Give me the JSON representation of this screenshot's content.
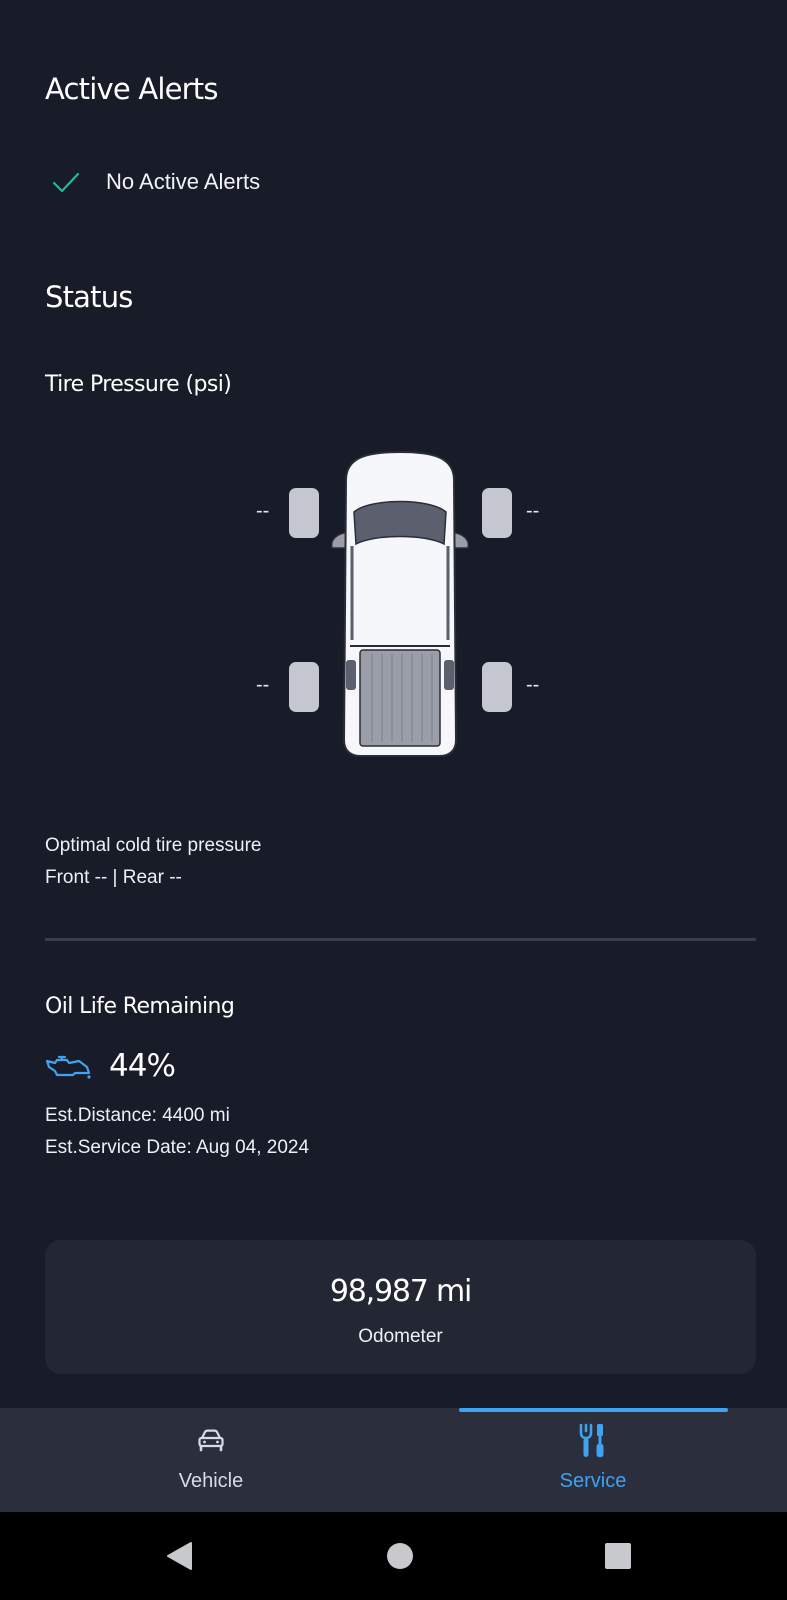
{
  "alerts": {
    "title": "Active Alerts",
    "status_text": "No Active Alerts"
  },
  "status": {
    "title": "Status",
    "tire_pressure": {
      "title": "Tire Pressure (psi)",
      "front_left": "--",
      "front_right": "--",
      "rear_left": "--",
      "rear_right": "--",
      "optimal_label": "Optimal cold tire pressure",
      "optimal_values": "Front -- | Rear --"
    },
    "oil_life": {
      "title": "Oil Life Remaining",
      "percent": "44%",
      "est_distance": "Est.Distance: 4400 mi",
      "est_service_date": "Est.Service Date: Aug 04, 2024"
    },
    "odometer": {
      "value": "98,987 mi",
      "label": "Odometer"
    }
  },
  "bottom_nav": {
    "items": [
      {
        "label": "Vehicle",
        "icon": "car-icon",
        "selected": false
      },
      {
        "label": "Service",
        "icon": "wrench-screwdriver-icon",
        "selected": true
      }
    ]
  },
  "android_nav": {
    "back_icon": "back-triangle-icon",
    "home_icon": "home-circle-icon",
    "recents_icon": "recents-square-icon"
  },
  "colors": {
    "background": "#181b28",
    "card": "#232633",
    "nav_background": "#2b2e3c",
    "accent": "#3ea3f0",
    "check_green": "#2bb59a",
    "nav_inactive": "#d8dbe4"
  }
}
